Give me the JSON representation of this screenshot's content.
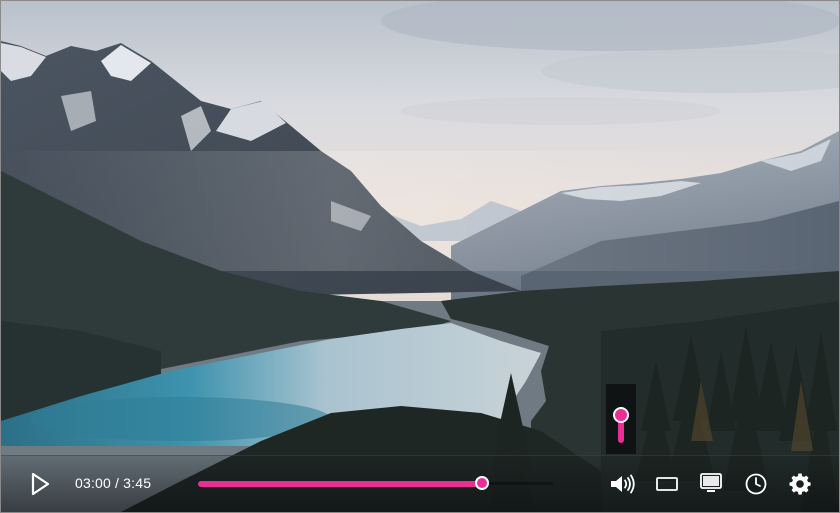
{
  "player": {
    "current_time": "03:00",
    "separator": "/",
    "duration": "3:45",
    "progress_fraction": 0.8,
    "volume_fraction": 0.55,
    "accent_color": "#ea2e96"
  },
  "icons": {
    "play": "play-icon",
    "volume": "volume-icon",
    "captions": "captions-icon",
    "tv": "tv-icon",
    "clock": "clock-icon",
    "settings": "gear-icon"
  }
}
